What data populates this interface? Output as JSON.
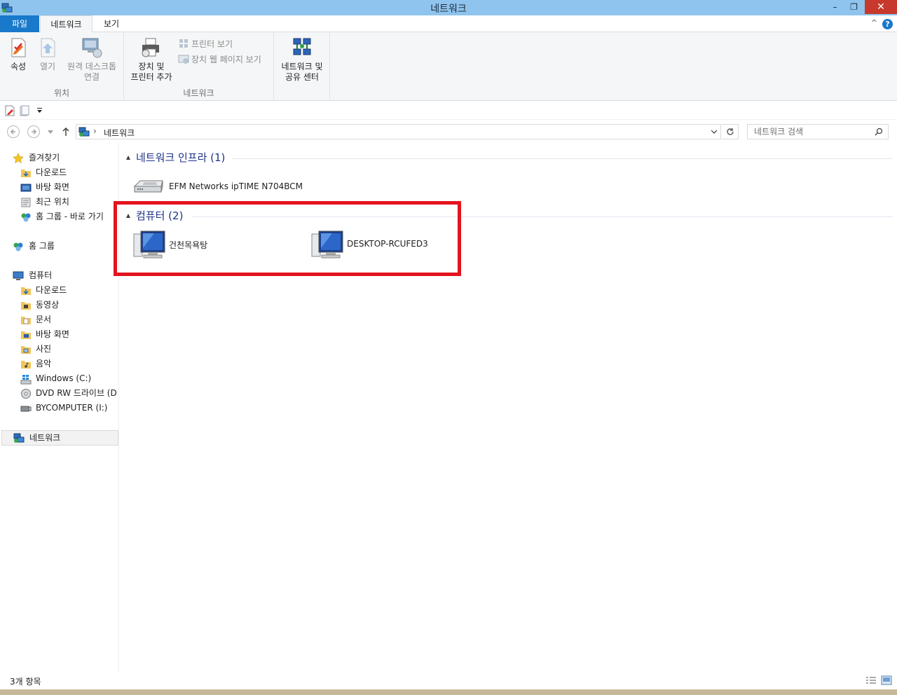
{
  "window": {
    "title": "네트워크",
    "minimize": "–",
    "maximize": "❐",
    "close": "✕"
  },
  "ribbon_tabs": {
    "file": "파일",
    "network": "네트워크",
    "view": "보기",
    "help": "?",
    "collapse": "^"
  },
  "ribbon": {
    "location_group": {
      "label": "위치",
      "properties": "속성",
      "open": "열기",
      "remote_line1": "원격 데스크톱",
      "remote_line2": "연결"
    },
    "network_group": {
      "label": "네트워크",
      "add_devices_line1": "장치 및",
      "add_devices_line2": "프린터 추가",
      "view_printers": "프린터 보기",
      "view_device_webpage": "장치 웹 페이지 보기"
    },
    "sharing_center": {
      "line1": "네트워크 및",
      "line2": "공유 센터"
    }
  },
  "address_bar": {
    "separator": "›",
    "location": "네트워크",
    "search_placeholder": "네트워크 검색"
  },
  "nav_pane": {
    "favorites": "즐겨찾기",
    "fav_items": [
      "다운로드",
      "바탕 화면",
      "최근 위치",
      "홈 그룹 - 바로 가기"
    ],
    "homegroup": "홈 그룹",
    "computer": "컴퓨터",
    "computer_items": [
      "다운로드",
      "동영상",
      "문서",
      "바탕 화면",
      "사진",
      "음악",
      "Windows (C:)",
      "DVD RW 드라이브 (D",
      "BYCOMPUTER (I:)"
    ],
    "network": "네트워크"
  },
  "groups": [
    {
      "title": "네트워크 인프라 (1)",
      "items": [
        "EFM Networks ipTIME N704BCM"
      ]
    },
    {
      "title": "컴퓨터 (2)",
      "items": [
        "건천목욕탕",
        "DESKTOP-RCUFED3"
      ]
    }
  ],
  "status_bar": {
    "count": "3개 항목"
  },
  "colors": {
    "titlebar": "#8fc4ee",
    "file_tab": "#1979ca",
    "close": "#c7392c",
    "highlight": "#e3141f",
    "group_title": "#1e3287"
  }
}
